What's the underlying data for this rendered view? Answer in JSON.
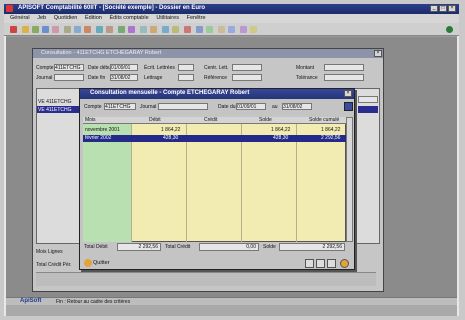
{
  "app": {
    "title": "APISOFT Comptabilité 60IIT - [Société exemple] - Dossier en Euro",
    "menu": [
      "Général",
      "Jeb",
      "Quotidien",
      "Édition",
      "Édits comptable",
      "Utilitaires",
      "Fenêtre"
    ]
  },
  "bg_dialog": {
    "title": "Consultation - 411ETCHG ETCHEGARAY Robert",
    "compte_label": "Compte",
    "compte_value": "411ETCHG",
    "date_debut_label": "Date début",
    "date_debut_value": "01/09/01",
    "ecrit_label": "Écrit. Lettrées",
    "centr_label": "Centr. Lett.",
    "journal_label": "Journal",
    "date_fin_label": "Date fin",
    "date_fin_value": "31/08/02",
    "lettrage_label": "Lettrage",
    "reference_label": "Référence",
    "montant_label": "Montant",
    "tolerance_label": "Tolérance",
    "rows": [
      {
        "jl": "VE",
        "compte": "411ETCHG"
      },
      {
        "jl": "VE",
        "compte": "411ETCHG"
      }
    ],
    "side_labels": [
      "Mois Lignes",
      "Total Crédit Pér."
    ]
  },
  "dialog": {
    "title": "Consultation mensuelle - Compte ETCHEGARAY Robert",
    "compte_label": "Compte",
    "compte_value": "411ETCHG",
    "journal_label": "Journal",
    "date_du_label": "Date du",
    "date_du_value": "01/09/01",
    "au_label": "au",
    "au_value": "31/08/02",
    "columns": [
      "Mois",
      "Débit",
      "Crédit",
      "Solde",
      "Solde cumulé"
    ],
    "rows": [
      {
        "mois": "novembre 2001",
        "debit": "1 864,22",
        "credit": "",
        "solde": "1 864,22",
        "cumul": "1 864,22"
      },
      {
        "mois": "février 2002",
        "debit": "428,30",
        "credit": "",
        "solde": "428,30",
        "cumul": "2 292,56"
      }
    ],
    "totals": {
      "debit_label": "Total Débit",
      "debit_value": "2 292,56",
      "credit_label": "Total Crédit",
      "credit_value": "0,00",
      "solde_label": "Solde",
      "solde_value": "2 292,56"
    },
    "quit_label": "Quitter"
  },
  "status": {
    "brand": "ApiSoft",
    "text": "Fin : Retour au cadre des critères"
  }
}
